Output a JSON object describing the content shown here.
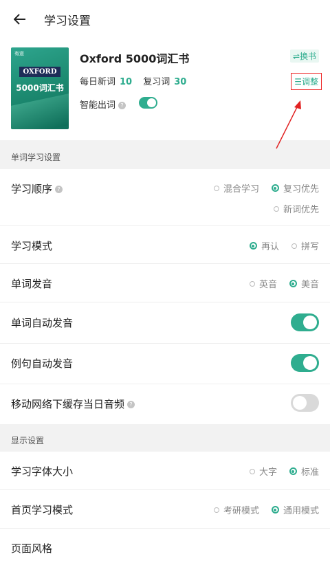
{
  "header": {
    "title": "学习设置",
    "back_icon": "arrow-left-icon"
  },
  "book": {
    "cover_brand": "有道",
    "cover_oxford": "OXFORD",
    "cover_title": "5000词汇书",
    "title": "Oxford 5000词汇书",
    "daily_new_label": "每日新词",
    "daily_new_value": "10",
    "review_label": "复习词",
    "review_value": "30",
    "smart_label": "智能出词",
    "smart_help": "?",
    "switch_label": "⇌换书",
    "adjust_label": "☰调整"
  },
  "sections": {
    "word_settings": "单词学习设置",
    "display_settings": "显示设置"
  },
  "settings": {
    "order": {
      "label": "学习顺序",
      "opt1": "混合学习",
      "opt2": "复习优先",
      "opt3": "新词优先"
    },
    "mode": {
      "label": "学习模式",
      "opt1": "再认",
      "opt2": "拼写"
    },
    "pron": {
      "label": "单词发音",
      "opt1": "英音",
      "opt2": "美音"
    },
    "auto_word": {
      "label": "单词自动发音"
    },
    "auto_sentence": {
      "label": "例句自动发音"
    },
    "cache": {
      "label": "移动网络下缓存当日音频"
    },
    "font": {
      "label": "学习字体大小",
      "opt1": "大字",
      "opt2": "标准"
    },
    "home_mode": {
      "label": "首页学习模式",
      "opt1": "考研模式",
      "opt2": "通用模式"
    },
    "style": {
      "label": "页面风格"
    }
  },
  "colors": {
    "accent": "#2fad8f",
    "annotation": "#e22222"
  }
}
